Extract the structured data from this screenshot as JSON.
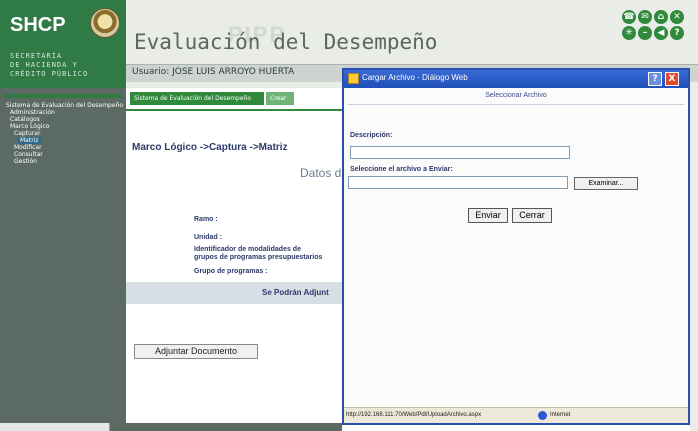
{
  "header": {
    "logo": "SHCP",
    "secretaria_lines": [
      "SECRETARÍA",
      "DE HACIENDA Y",
      "CRÉDITO PÚBLICO"
    ],
    "app_title": "Evaluación del Desempeño",
    "watermark": "PIPP",
    "user": "Usuario: JOSE LUIS ARROYO HUERTA"
  },
  "header_icons": [
    "phone-icon",
    "mail-icon",
    "home-icon",
    "close-icon",
    "star-icon",
    "minus-icon",
    "back-icon",
    "help-icon"
  ],
  "sidebar": {
    "items": [
      {
        "label": "Sistema de Evaluación del Desempeño",
        "indent": 0,
        "highlight": false
      },
      {
        "label": "Administración",
        "indent": 1,
        "highlight": false
      },
      {
        "label": "Catálogos",
        "indent": 1,
        "highlight": false
      },
      {
        "label": "Marco Lógico",
        "indent": 1,
        "highlight": false
      },
      {
        "label": "Capturar",
        "indent": 2,
        "highlight": false
      },
      {
        "label": "Matriz",
        "indent": 3,
        "highlight": true
      },
      {
        "label": "Modificar",
        "indent": 2,
        "highlight": false
      },
      {
        "label": "Consultar",
        "indent": 2,
        "highlight": false
      },
      {
        "label": "Gestión",
        "indent": 2,
        "highlight": false
      }
    ]
  },
  "main": {
    "tab_active": "Sistema de Evaluación del Desempeño",
    "tab_other": "Crear",
    "breadcrumb": "Marco Lógico ->Captura ->Matriz",
    "section_title": "Datos d",
    "fields": [
      "Ramo :",
      "Unidad :",
      "Identificador de modalidades de",
      "grupos de programas presupuestarios",
      "Grupo de programas :"
    ],
    "attach_notice": "Se Podrán Adjunt",
    "attach_button": "Adjuntar Documento"
  },
  "dialog": {
    "title": "Cargar Archivo - Diálogo Web",
    "subtitle": "Seleccionar Archivo",
    "description_label": "Descripción:",
    "description_value": "",
    "file_label": "Seleccione el archivo a Enviar:",
    "file_value": "",
    "browse_button": "Examinar...",
    "send_button": "Enviar",
    "close_button": "Cerrar",
    "help_glyph": "?",
    "close_glyph": "X",
    "status_url": "http://192.168.111.70/Web/Pdl/UploadArchivo.aspx",
    "status_zone": "Internet"
  },
  "colors": {
    "brand_green": "#2f7a45",
    "dialog_blue": "#2a4eb0",
    "sidebar_gray": "#5b6a62"
  }
}
